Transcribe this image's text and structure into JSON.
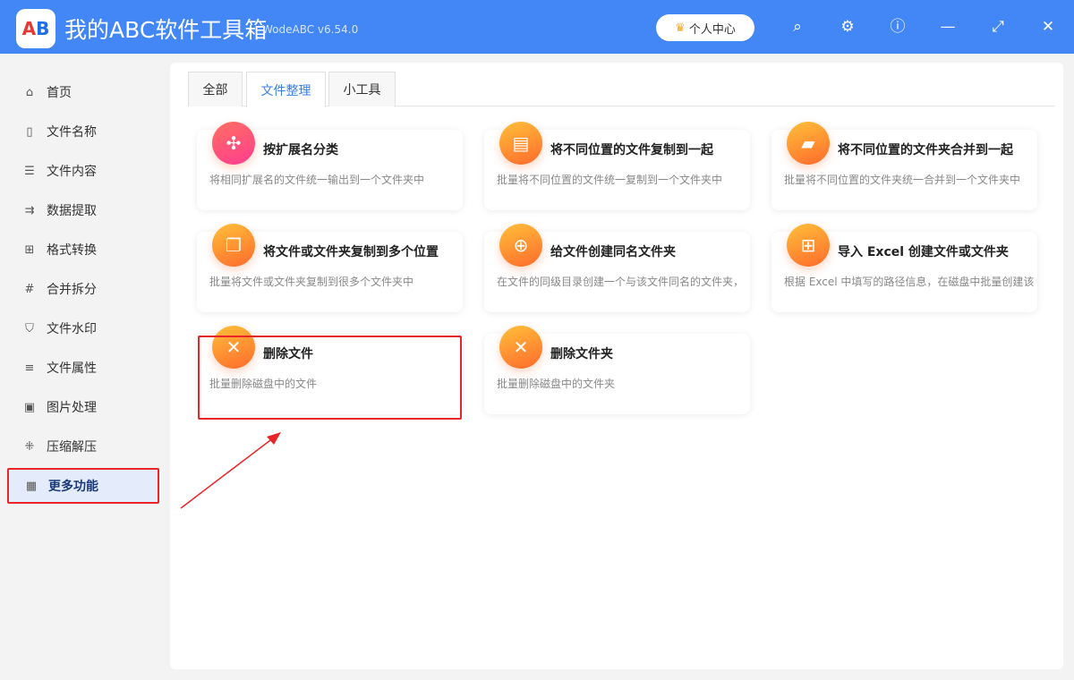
{
  "app": {
    "title": "我的ABC软件工具箱",
    "version": "WodeABC v6.54.0",
    "logo_text": "AB",
    "user_center": "个人中心"
  },
  "window_icons": [
    "search-icon",
    "gear-icon",
    "help-icon",
    "minimize-icon",
    "maximize-icon",
    "close-icon"
  ],
  "sidebar": {
    "items": [
      {
        "label": "首页",
        "icon": "home-icon"
      },
      {
        "label": "文件名称",
        "icon": "file-icon"
      },
      {
        "label": "文件内容",
        "icon": "list-icon"
      },
      {
        "label": "数据提取",
        "icon": "extract-icon"
      },
      {
        "label": "格式转换",
        "icon": "convert-icon"
      },
      {
        "label": "合并拆分",
        "icon": "hash-icon"
      },
      {
        "label": "文件水印",
        "icon": "shield-icon"
      },
      {
        "label": "文件属性",
        "icon": "properties-icon"
      },
      {
        "label": "图片处理",
        "icon": "image-icon"
      },
      {
        "label": "压缩解压",
        "icon": "compress-icon"
      },
      {
        "label": "更多功能",
        "icon": "grid-icon",
        "active": true
      }
    ]
  },
  "tabs": [
    {
      "label": "全部"
    },
    {
      "label": "文件整理",
      "active": true
    },
    {
      "label": "小工具"
    }
  ],
  "cards": [
    {
      "title": "按扩展名分类",
      "desc": "将相同扩展名的文件统一输出到一个文件夹中",
      "color": "pink"
    },
    {
      "title": "将不同位置的文件复制到一起",
      "desc": "批量将不同位置的文件统一复制到一个文件夹中",
      "color": "orange"
    },
    {
      "title": "将不同位置的文件夹合并到一起",
      "desc": "批量将不同位置的文件夹统一合并到一个文件夹中",
      "color": "orange"
    },
    {
      "title": "将文件或文件夹复制到多个位置",
      "desc": "批量将文件或文件夹复制到很多个文件夹中",
      "color": "orange"
    },
    {
      "title": "给文件创建同名文件夹",
      "desc": "在文件的同级目录创建一个与该文件同名的文件夹，",
      "color": "orange"
    },
    {
      "title": "导入 Excel 创建文件或文件夹",
      "desc": "根据 Excel 中填写的路径信息，在磁盘中批量创建该",
      "color": "orange"
    },
    {
      "title": "删除文件",
      "desc": "批量删除磁盘中的文件",
      "color": "orange"
    },
    {
      "title": "删除文件夹",
      "desc": "批量删除磁盘中的文件夹",
      "color": "orange"
    }
  ]
}
